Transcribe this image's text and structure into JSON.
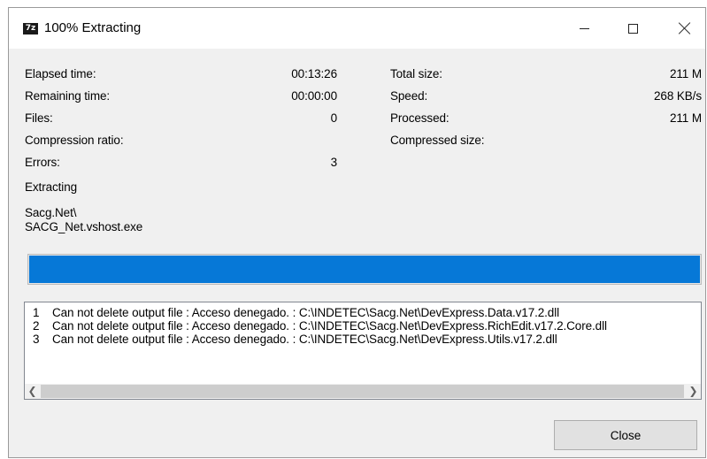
{
  "window": {
    "icon_text": "7z",
    "title": "100% Extracting"
  },
  "stats": {
    "elapsed_label": "Elapsed time:",
    "elapsed_value": "00:13:26",
    "remaining_label": "Remaining time:",
    "remaining_value": "00:00:00",
    "files_label": "Files:",
    "files_value": "0",
    "ratio_label": "Compression ratio:",
    "errors_label": "Errors:",
    "errors_value": "3",
    "total_size_label": "Total size:",
    "total_size_value": "211 M",
    "speed_label": "Speed:",
    "speed_value": "268 KB/s",
    "processed_label": "Processed:",
    "processed_value": "211 M",
    "compressed_label": "Compressed size:"
  },
  "status": {
    "operation": "Extracting",
    "current_path": "Sacg.Net\\",
    "current_file": "SACG_Net.vshost.exe"
  },
  "progress": {
    "percent": 100,
    "fill_color": "#0678d7"
  },
  "log": {
    "rows": [
      {
        "index": "1",
        "message": "Can not delete output file : Acceso denegado. : C:\\INDETEC\\Sacg.Net\\DevExpress.Data.v17.2.dll"
      },
      {
        "index": "2",
        "message": "Can not delete output file : Acceso denegado. : C:\\INDETEC\\Sacg.Net\\DevExpress.RichEdit.v17.2.Core.dll"
      },
      {
        "index": "3",
        "message": "Can not delete output file : Acceso denegado. : C:\\INDETEC\\Sacg.Net\\DevExpress.Utils.v17.2.dll"
      }
    ]
  },
  "buttons": {
    "close_label": "Close"
  },
  "icons": {
    "app": "7zip-icon",
    "minimize": "minimize-icon",
    "maximize": "maximize-icon",
    "close": "close-icon",
    "scroll_left": "chevron-left-icon",
    "scroll_right": "chevron-right-icon"
  }
}
